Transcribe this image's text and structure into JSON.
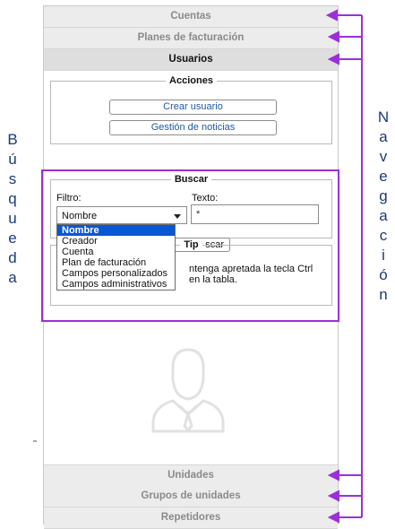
{
  "sections_top": [
    {
      "label": "Cuentas"
    },
    {
      "label": "Planes de facturación"
    },
    {
      "label": "Usuarios"
    }
  ],
  "acciones": {
    "legend": "Acciones",
    "buttons": [
      "Crear usuario",
      "Gestión de noticias"
    ]
  },
  "buscar": {
    "legend": "Buscar",
    "filtro_label": "Filtro:",
    "filtro_value": "Nombre",
    "texto_label": "Texto:",
    "texto_value": "*",
    "button_partial": "scar",
    "options": [
      "Nombre",
      "Creador",
      "Cuenta",
      "Plan de facturación",
      "Campos personalizados",
      "Campos administrativos"
    ]
  },
  "tip": {
    "legend": "Tip",
    "line1": "ntenga apretada la tecla Ctrl",
    "line2": "en la tabla."
  },
  "sections_bottom": [
    {
      "label": "Unidades"
    },
    {
      "label": "Grupos de unidades"
    },
    {
      "label": "Repetidores"
    }
  ],
  "annotations": {
    "busqueda_letters": [
      "B",
      "ú",
      "s",
      "q",
      "u",
      "e",
      "d",
      "a"
    ],
    "navegacion_letters": [
      "N",
      "a",
      "v",
      "e",
      "g",
      "a",
      "c",
      "i",
      "ó",
      "n"
    ],
    "highlight_color": "#9b30d9",
    "label_color": "#1b3a78"
  },
  "icons": {
    "avatar": "user-silhouette-icon",
    "arrow": "arrow-left-icon"
  }
}
